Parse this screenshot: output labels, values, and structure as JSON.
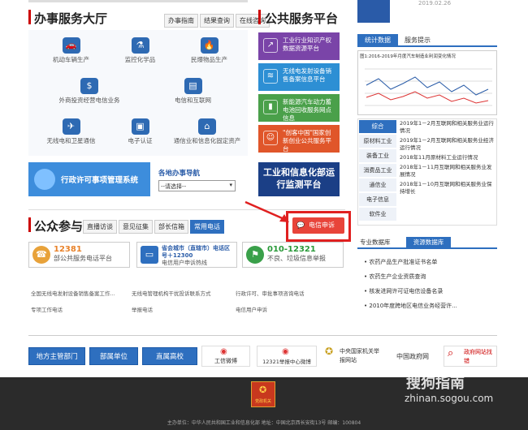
{
  "service_hall": {
    "title": "办事服务大厅",
    "tabs": [
      "办事指南",
      "结果查询",
      "在线咨询"
    ],
    "items": [
      {
        "label": "机动车辆生产",
        "icon": "car-icon"
      },
      {
        "label": "监控化学品",
        "icon": "flask-icon"
      },
      {
        "label": "民爆物品生产",
        "icon": "flame-icon"
      },
      {
        "label": "外商投资经营电信业务",
        "icon": "building-icon"
      },
      {
        "label": "电信和互联网",
        "icon": "doc-icon"
      },
      {
        "label": "无线电和卫星通信",
        "icon": "satellite-icon"
      },
      {
        "label": "电子认证",
        "icon": "id-card-icon"
      },
      {
        "label": "通信业和信息化固定资产",
        "icon": "house-icon"
      }
    ],
    "permit_system": "行政许可事项管理系统",
    "local_nav_label": "各地办事导航",
    "select_value": "--请选择--"
  },
  "public_platform": {
    "title": "公共服务平台",
    "items": [
      {
        "label": "工业行业知识产权数据资源平台",
        "color": "#7a44a8"
      },
      {
        "label": "无线电发射设备销售备案信息平台",
        "color": "#2d8fd4"
      },
      {
        "label": "新能源汽车动力蓄电池回收服务网点信息",
        "color": "#4aa04a"
      },
      {
        "label": "\"创客中国\"国家创新创业公共服务平台",
        "color": "#e0562a"
      }
    ],
    "monitor": "工业和信息化部运行监测平台"
  },
  "stats": {
    "tabs": [
      "统计数据",
      "服务提示"
    ],
    "chart_caption": "图1:2016-2019年月度汽车制造业利润变化情况",
    "categories": [
      "综合",
      "原材料工业",
      "装备工业",
      "消费品工业",
      "通信业",
      "电子信息",
      "软件业"
    ],
    "news": [
      "2019年1－2月互联网和相关服务业运行情况",
      "2019年1－2月互联网和相关服务业经济运行情况",
      "2018年11月原材料工业运行情况",
      "2018年1－11月互联网和相关服务业发展情况",
      "2018年1－10月互联网和相关服务业保持增长"
    ]
  },
  "public_participation": {
    "title": "公众参与",
    "tabs": [
      "直播访谈",
      "意见征集",
      "部长信箱",
      "常用电话"
    ],
    "complaint_button": "电信申诉",
    "hotlines": [
      {
        "number": "12381",
        "desc": "部公共服务电话平台"
      },
      {
        "number": "省会城市（直辖市）电话区号＋12300",
        "desc": "电信用户申诉热线"
      },
      {
        "number": "010-12321",
        "desc": "不良、垃圾信息举报"
      }
    ],
    "links": [
      "全国无线电发射设备销售备案工作...",
      "无线电管理机构干扰投诉联系方式",
      "行政许可、审批事项咨询电话",
      "专项工作电话",
      "举报电话",
      "电信用户申诉"
    ]
  },
  "pro_db": {
    "tabs": [
      "专业数据库",
      "资源数据库"
    ],
    "items": [
      "农药产品生产批准证书名单",
      "农药生产企业资质查询",
      "核发进网许可证电信设备名录",
      "2010年度跨地区电信业务经营许..."
    ]
  },
  "bottom": {
    "buttons": [
      "地方主管部门",
      "部属单位",
      "直属高校"
    ],
    "weibo": [
      "工信微博",
      "12321举报中心微博"
    ],
    "report_center": "中央国家机关举报网站",
    "gov_portal": "中国政府网",
    "error_finder": "政府网站找错"
  },
  "footer": {
    "text": "主办单位：中华人民共和国工业和信息化部 地址：中国北京西长安街13号 邮编：100804",
    "watermark": "搜狗指南",
    "watermark_url": "zhinan.sogou.com",
    "emblem": "党政机关"
  },
  "top_banner": "2019.02.26"
}
